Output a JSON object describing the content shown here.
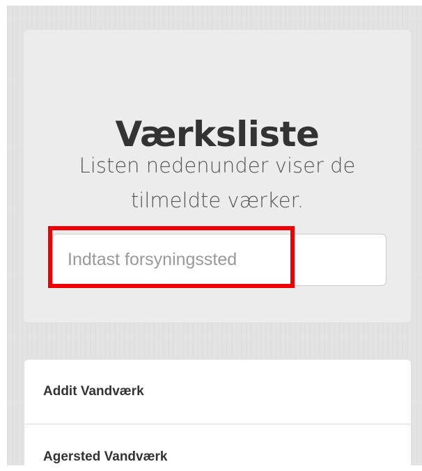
{
  "hero": {
    "title": "Værksliste",
    "subtitle": "Listen nedenunder viser de tilmeldte værker."
  },
  "search": {
    "placeholder": "Indtast forsyningssted",
    "value": ""
  },
  "list": {
    "items": [
      {
        "label": "Addit Vandværk"
      },
      {
        "label": "Agersted Vandværk"
      }
    ]
  },
  "colors": {
    "page_background": "#e3e3e3",
    "card_background": "#ececec",
    "title_text": "#333333",
    "subtitle_text": "#555555",
    "highlight_outline": "#ee0000"
  }
}
